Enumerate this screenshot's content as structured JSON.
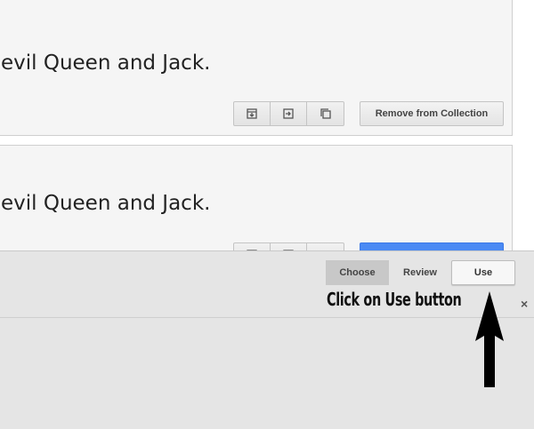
{
  "cards": [
    {
      "text": "evil Queen and Jack.",
      "action_label": "Remove from Collection"
    },
    {
      "text": "evil Queen and Jack.",
      "action_label": ""
    }
  ],
  "tabs": [
    "Choose",
    "Review",
    "Use"
  ],
  "instruction": "Click on Use button",
  "close_symbol": "×",
  "colors": {
    "card_bg": "#f5f5f5",
    "panel_bg": "#e5e5e5",
    "primary_blue": "#4a8af4",
    "active_tab": "#c8c8c8"
  },
  "icons": [
    "archive-icon",
    "move-icon",
    "copy-icon"
  ]
}
